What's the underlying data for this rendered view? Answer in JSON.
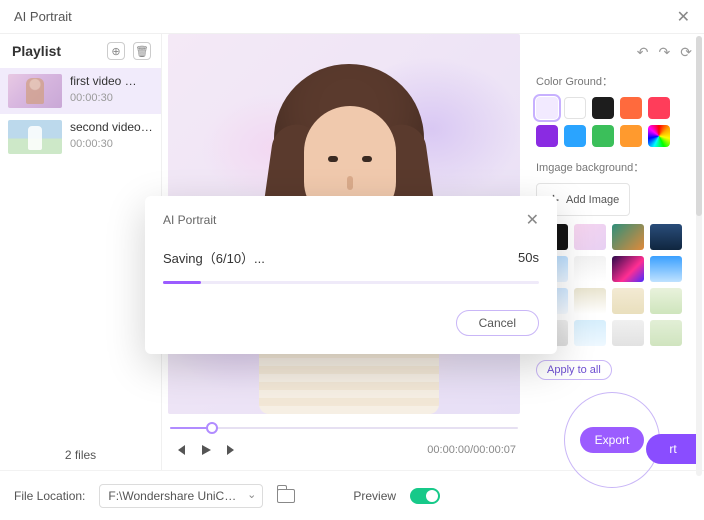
{
  "app": {
    "title": "AI Portrait"
  },
  "playlist": {
    "title": "Playlist",
    "items": [
      {
        "name": "first video …",
        "duration": "00:00:30"
      },
      {
        "name": "second video…",
        "duration": "00:00:30"
      }
    ],
    "count_label": "2 files"
  },
  "player": {
    "timecode": "00:00:00/00:00:07"
  },
  "right": {
    "color_ground_label": "Color Ground：",
    "swatches": [
      "#f2eaff",
      "#ffffff",
      "#1d1d1d",
      "#ff6a3d",
      "#ff3d5a",
      "#8a2be2",
      "#2aa4ff",
      "#3bbf5a",
      "#ff9a2e",
      "rainbow"
    ],
    "image_bg_label": "Imgage background：",
    "add_image_label": "Add Image",
    "apply_label": "Apply to all",
    "export_label": "Export",
    "fab_label": "rt"
  },
  "bottom": {
    "location_label": "File Location:",
    "path": "F:\\Wondershare UniConverter…",
    "preview_label": "Preview"
  },
  "modal": {
    "title": "AI Portrait",
    "status": "Saving（6/10）...",
    "remaining": "50s",
    "cancel_label": "Cancel"
  },
  "backgrounds": [
    "#141414",
    "linear-gradient(135deg,#f7d5ef,#e7d0f3)",
    "linear-gradient(135deg,#2e8f7a,#e08a3a)",
    "linear-gradient(180deg,#2a4d7a,#10263f)",
    "linear-gradient(180deg,#bde0ff,#e9f4ff)",
    "linear-gradient(180deg,#f2f2f2,#ffffff)",
    "linear-gradient(135deg,#2a0a4a,#ff2e92 60%,#4a2aff)",
    "linear-gradient(180deg,#3aa0ff,#bfe2ff)",
    "linear-gradient(180deg,#d0e8ff,#f5faff)",
    "linear-gradient(180deg,#e9e4cf,#fff)",
    "linear-gradient(180deg,#f3ead3,#e9dfbd)",
    "linear-gradient(180deg,#e9f2dc,#cfe5bd)",
    "linear-gradient(180deg,#eeeeee,#dddddd)",
    "linear-gradient(180deg,#d6eefc,#eef8ff)",
    "linear-gradient(180deg,#f0f0f0,#e2e2e2)",
    "linear-gradient(180deg,#e2efd6,#d0e4bf)"
  ]
}
